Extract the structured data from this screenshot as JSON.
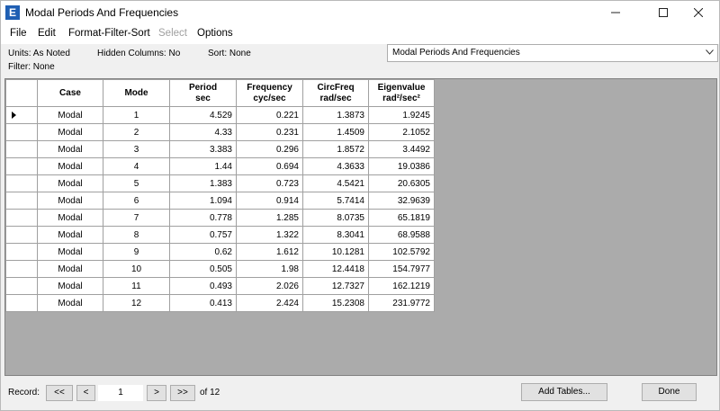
{
  "window": {
    "app_icon_letter": "E",
    "title": "Modal Periods And Frequencies"
  },
  "menu": [
    {
      "label": "File",
      "enabled": true
    },
    {
      "label": "Edit",
      "enabled": true
    },
    {
      "label": "Format-Filter-Sort",
      "enabled": true
    },
    {
      "label": "Select",
      "enabled": false
    },
    {
      "label": "Options",
      "enabled": true
    }
  ],
  "info": {
    "units": "Units:  As Noted",
    "hidden_columns": "Hidden Columns:  No",
    "sort": "Sort:  None",
    "filter": "Filter:  None"
  },
  "table_selector": {
    "value": "Modal Periods And Frequencies"
  },
  "grid": {
    "columns": [
      {
        "name": "Case",
        "unit": ""
      },
      {
        "name": "Mode",
        "unit": ""
      },
      {
        "name": "Period",
        "unit": "sec"
      },
      {
        "name": "Frequency",
        "unit": "cyc/sec"
      },
      {
        "name": "CircFreq",
        "unit": "rad/sec"
      },
      {
        "name": "Eigenvalue",
        "unit": "rad²/sec²"
      }
    ],
    "rows": [
      [
        "Modal",
        "1",
        "4.529",
        "0.221",
        "1.3873",
        "1.9245"
      ],
      [
        "Modal",
        "2",
        "4.33",
        "0.231",
        "1.4509",
        "2.1052"
      ],
      [
        "Modal",
        "3",
        "3.383",
        "0.296",
        "1.8572",
        "3.4492"
      ],
      [
        "Modal",
        "4",
        "1.44",
        "0.694",
        "4.3633",
        "19.0386"
      ],
      [
        "Modal",
        "5",
        "1.383",
        "0.723",
        "4.5421",
        "20.6305"
      ],
      [
        "Modal",
        "6",
        "1.094",
        "0.914",
        "5.7414",
        "32.9639"
      ],
      [
        "Modal",
        "7",
        "0.778",
        "1.285",
        "8.0735",
        "65.1819"
      ],
      [
        "Modal",
        "8",
        "0.757",
        "1.322",
        "8.3041",
        "68.9588"
      ],
      [
        "Modal",
        "9",
        "0.62",
        "1.612",
        "10.1281",
        "102.5792"
      ],
      [
        "Modal",
        "10",
        "0.505",
        "1.98",
        "12.4418",
        "154.7977"
      ],
      [
        "Modal",
        "11",
        "0.493",
        "2.026",
        "12.7327",
        "162.1219"
      ],
      [
        "Modal",
        "12",
        "0.413",
        "2.424",
        "15.2308",
        "231.9772"
      ]
    ],
    "current_row": 0
  },
  "footer": {
    "record_label": "Record:",
    "first_label": "<<",
    "prev_label": "<",
    "record_value": "1",
    "next_label": ">",
    "last_label": ">>",
    "of_text": "of 12",
    "add_tables_label": "Add Tables...",
    "done_label": "Done"
  }
}
